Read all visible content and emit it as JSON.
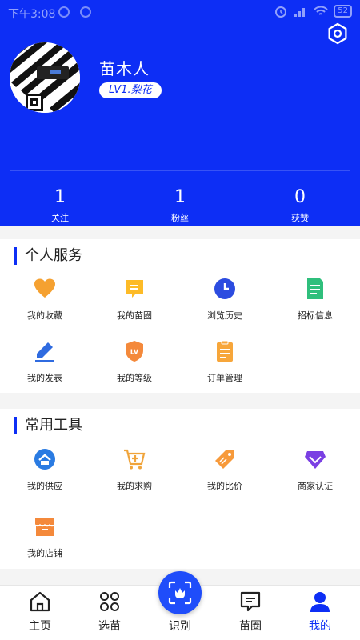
{
  "status_bar": {
    "time": "下午3:08",
    "battery": "52"
  },
  "profile": {
    "name": "苗木人",
    "level": "LV1.梨花"
  },
  "stats": [
    {
      "value": "1",
      "label": "关注"
    },
    {
      "value": "1",
      "label": "粉丝"
    },
    {
      "value": "0",
      "label": "获赞"
    }
  ],
  "personal_services": {
    "title": "个人服务",
    "items": [
      {
        "label": "我的收藏",
        "icon": "heart-icon"
      },
      {
        "label": "我的苗圈",
        "icon": "message-icon"
      },
      {
        "label": "浏览历史",
        "icon": "clock-icon"
      },
      {
        "label": "招标信息",
        "icon": "document-icon"
      },
      {
        "label": "我的发表",
        "icon": "pencil-icon"
      },
      {
        "label": "我的等级",
        "icon": "level-shield-icon"
      },
      {
        "label": "订单管理",
        "icon": "clipboard-icon"
      }
    ]
  },
  "tools": {
    "title": "常用工具",
    "items": [
      {
        "label": "我的供应",
        "icon": "supply-icon"
      },
      {
        "label": "我的求购",
        "icon": "cart-icon"
      },
      {
        "label": "我的比价",
        "icon": "price-tag-icon"
      },
      {
        "label": "商家认证",
        "icon": "diamond-icon"
      },
      {
        "label": "我的店铺",
        "icon": "store-icon"
      }
    ]
  },
  "bottom_nav": [
    {
      "label": "主页",
      "icon": "home-icon"
    },
    {
      "label": "选苗",
      "icon": "category-icon"
    },
    {
      "label": "识别",
      "icon": "scan-flower-icon"
    },
    {
      "label": "苗圈",
      "icon": "chat-icon"
    },
    {
      "label": "我的",
      "icon": "person-icon",
      "active": true
    }
  ],
  "colors": {
    "primary": "#0d2ef5",
    "heart": "#f5a131",
    "message": "#fdbb27",
    "clock": "#2c4ce0",
    "document": "#2fbf7c",
    "pencil": "#2f6be0",
    "level": "#f4893b",
    "clipboard": "#f7a63a",
    "supply": "#2a7be2",
    "cart": "#f0a43b",
    "tag": "#f79a3b",
    "diamond": "#7a3fe3",
    "store": "#f4893b"
  }
}
